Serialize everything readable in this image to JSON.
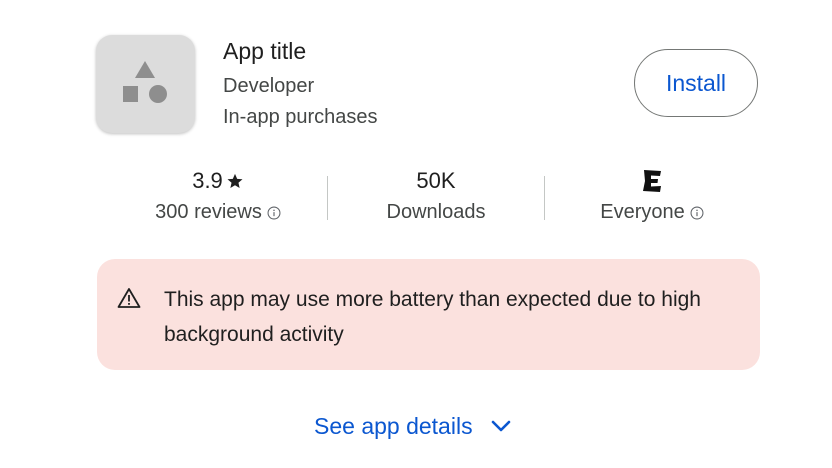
{
  "app": {
    "title": "App title",
    "developer": "Developer",
    "in_app_purchases": "In-app purchases",
    "icon": "app-placeholder-shapes-icon"
  },
  "install_button": {
    "label": "Install"
  },
  "stats": {
    "rating": {
      "value": "3.9",
      "star_icon": "star-icon",
      "reviews_label": "300 reviews",
      "info_icon": "info-icon"
    },
    "downloads": {
      "value": "50K",
      "label": "Downloads"
    },
    "content_rating": {
      "badge_icon": "esrb-e-icon",
      "label": "Everyone",
      "info_icon": "info-icon"
    }
  },
  "warning": {
    "icon": "warning-triangle-icon",
    "text": "This app may use more battery than expected due to high background activity"
  },
  "details_link": {
    "label": "See app details",
    "icon": "chevron-down-icon"
  },
  "colors": {
    "accent": "#0b57d0",
    "warning_background": "#fbe1de",
    "icon_background": "#dcdcdc",
    "icon_shapes": "#8e8e8e"
  }
}
